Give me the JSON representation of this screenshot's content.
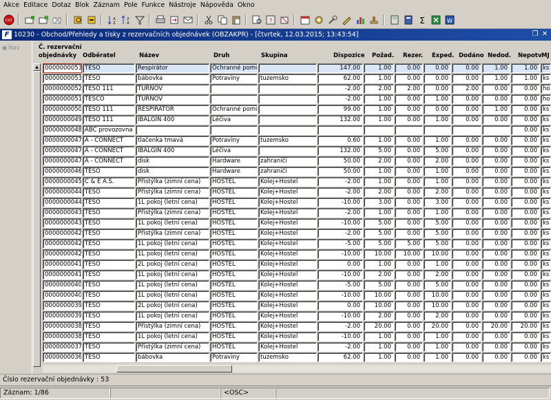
{
  "menu": [
    "Akce",
    "Editace",
    "Dotaz",
    "Blok",
    "Záznam",
    "Pole",
    "Funkce",
    "Nástroje",
    "Nápověda",
    "Okno"
  ],
  "toolbar": {
    "exit_label": "EXIT",
    "icons": [
      "exit-icon",
      "new-record-icon",
      "save-icon",
      "delete-icon",
      "query-icon",
      "execute-query-icon",
      "sort-asc-icon",
      "sort-desc-icon",
      "filter-icon",
      "print-icon",
      "export-icon",
      "email-icon",
      "cut-icon",
      "copy-icon",
      "paste-icon",
      "find-icon",
      "help-icon",
      "calendar-icon",
      "calculator-icon",
      "sum-icon",
      "excel-icon",
      "word-icon"
    ]
  },
  "window": {
    "title": "10230 - Obchod/Přehledy a tisky z rezervačních objednávek (OBZAKPR) - [čtvrtek, 12.03.2015; 13:43:54]"
  },
  "nav": {
    "label": "Nav"
  },
  "columns": {
    "c1a": "Č. rezervační",
    "c1b": "objednávky",
    "c2": "Odběratel",
    "c3": "Název",
    "c4": "Druh",
    "c5": "Skupina",
    "c6": "Dispozice",
    "c7": "Požad.",
    "c8": "Rezer.",
    "c9": "Exped.",
    "c10": "Dodáno",
    "c11": "Nedod.",
    "c12": "Nepotv.",
    "c13": "MJ"
  },
  "rows": [
    [
      "0000000053",
      "TESO",
      "Respirátor",
      "Ochranné pomůcky",
      "",
      "147.00",
      "1.00",
      "0.00",
      "0.00",
      "0.00",
      "1.00",
      "1.00",
      "ks"
    ],
    [
      "0000000053",
      "TESO",
      "bábovka",
      "Potraviny",
      "tuzemsko",
      "62.00",
      "1.00",
      "0.00",
      "0.00",
      "0.00",
      "1.00",
      "1.00",
      "ks"
    ],
    [
      "0000000052",
      "TESO 111",
      "TURNOV",
      "",
      "",
      "-2.00",
      "2.00",
      "2.00",
      "0.00",
      "2.00",
      "0.00",
      "0.00",
      "ho"
    ],
    [
      "0000000051",
      "TESCO",
      "TURNOV",
      "",
      "",
      "-2.00",
      "1.00",
      "0.00",
      "1.00",
      "0.00",
      "0.00",
      "0.00",
      "ho"
    ],
    [
      "0000000050",
      "TESO 111",
      "RESPIRÁTOR",
      "Ochranné pomůcky",
      "",
      "99.00",
      "1.00",
      "0.00",
      "0.00",
      "0.00",
      "1.00",
      "0.00",
      "ks"
    ],
    [
      "0000000049",
      "TESO 111",
      "IBALGIN 400",
      "Léčiva",
      "",
      "132.00",
      "1.00",
      "0.00",
      "1.00",
      "0.00",
      "0.00",
      "0.00",
      "ks"
    ],
    [
      "0000000048",
      "ABC provozovna Nový Bor",
      "",
      "",
      "",
      "",
      "",
      "",
      "",
      "",
      "",
      "0.00",
      "ks"
    ],
    [
      "0000000047",
      "A - CONNECT",
      "tlačenka tmavá",
      "Potraviny",
      "tuzemsko",
      "0.60",
      "1.00",
      "0.00",
      "1.00",
      "0.00",
      "0.00",
      "0.00",
      "ks"
    ],
    [
      "0000000047",
      "A - CONNECT",
      "IBALGIN 400",
      "Léčiva",
      "",
      "132.00",
      "5.00",
      "0.00",
      "5.00",
      "0.00",
      "0.00",
      "0.00",
      "ks"
    ],
    [
      "0000000047",
      "A - CONNECT",
      "disk",
      "Hardware",
      "zahraničí",
      "50.00",
      "2.00",
      "0.00",
      "2.00",
      "0.00",
      "0.00",
      "0.00",
      "ks"
    ],
    [
      "0000000046",
      "TESO",
      "disk",
      "Hardware",
      "zahraničí",
      "50.00",
      "1.00",
      "0.00",
      "1.00",
      "0.00",
      "0.00",
      "0.00",
      "ks"
    ],
    [
      "0000000045",
      "C & E A.S.",
      "Přistýlka (zimní cena)",
      "HOSTEL",
      "Kolej+Hostel",
      "-2.00",
      "1.00",
      "0.00",
      "1.00",
      "0.00",
      "0.00",
      "0.00",
      "ks"
    ],
    [
      "0000000044",
      "TESO",
      "Přistýlka (zimní cena)",
      "HOSTEL",
      "Kolej+Hostel",
      "-2.00",
      "2.00",
      "0.00",
      "2.00",
      "0.00",
      "0.00",
      "0.00",
      "ks"
    ],
    [
      "0000000044",
      "TESO",
      "1L pokoj (letní cena)",
      "HOSTEL",
      "Kolej+Hostel",
      "-10.00",
      "3.00",
      "0.00",
      "3.00",
      "0.00",
      "0.00",
      "0.00",
      "ks"
    ],
    [
      "0000000043",
      "TESO",
      "Přistýlka (zimní cena)",
      "HOSTEL",
      "Kolej+Hostel",
      "-2.00",
      "1.00",
      "0.00",
      "1.00",
      "0.00",
      "0.00",
      "0.00",
      "ks"
    ],
    [
      "0000000043",
      "TESO",
      "1L pokoj (letní cena)",
      "HOSTEL",
      "Kolej+Hostel",
      "-10.00",
      "5.00",
      "0.00",
      "5.00",
      "0.00",
      "0.00",
      "0.00",
      "ks"
    ],
    [
      "0000000042",
      "TESO",
      "Přistýlka (zimní cena)",
      "HOSTEL",
      "Kolej+Hostel",
      "-2.00",
      "5.00",
      "0.00",
      "5.00",
      "0.00",
      "0.00",
      "0.00",
      "ks"
    ],
    [
      "0000000042",
      "TESO",
      "1L pokoj (letní cena)",
      "HOSTEL",
      "Kolej+Hostel",
      "-5.00",
      "5.00",
      "5.00",
      "5.00",
      "0.00",
      "0.00",
      "0.00",
      "ks"
    ],
    [
      "0000000042",
      "TESO",
      "1L pokoj (letní cena)",
      "HOSTEL",
      "Kolej+Hostel",
      "-10.00",
      "10.00",
      "10.00",
      "10.00",
      "0.00",
      "0.00",
      "0.00",
      "ks"
    ],
    [
      "0000000041",
      "TESO",
      "2L pokoj (letní cena)",
      "HOSTEL",
      "Kolej+Hostel",
      "0.00",
      "1.00",
      "0.00",
      "1.00",
      "0.00",
      "0.00",
      "0.00",
      "ks"
    ],
    [
      "0000000041",
      "TESO",
      "1L pokoj (letní cena)",
      "HOSTEL",
      "Kolej+Hostel",
      "-10.00",
      "2.00",
      "0.00",
      "2.00",
      "0.00",
      "0.00",
      "0.00",
      "ks"
    ],
    [
      "0000000040",
      "TESO",
      "1L pokoj (letní cena)",
      "HOSTEL",
      "Kolej+Hostel",
      "-5.00",
      "5.00",
      "0.00",
      "5.00",
      "0.00",
      "0.00",
      "0.00",
      "ks"
    ],
    [
      "0000000040",
      "TESO",
      "1L pokoj (letní cena)",
      "HOSTEL",
      "Kolej+Hostel",
      "-10.00",
      "10.00",
      "0.00",
      "10.00",
      "0.00",
      "0.00",
      "0.00",
      "ks"
    ],
    [
      "0000000039",
      "TESO",
      "2L pokoj (letní cena)",
      "HOSTEL",
      "Kolej+Hostel",
      "0.00",
      "10.00",
      "0.00",
      "10.00",
      "0.00",
      "0.00",
      "0.00",
      "ks"
    ],
    [
      "0000000039",
      "TESO",
      "1L pokoj (letní cena)",
      "HOSTEL",
      "Kolej+Hostel",
      "-10.00",
      "2.00",
      "0.00",
      "2.00",
      "0.00",
      "0.00",
      "0.00",
      "ks"
    ],
    [
      "0000000038",
      "TESO",
      "Přistýlka (zimní cena)",
      "HOSTEL",
      "Kolej+Hostel",
      "-2.00",
      "20.00",
      "0.00",
      "20.00",
      "0.00",
      "20.00",
      "20.00",
      "ks"
    ],
    [
      "0000000038",
      "TESO",
      "1L pokoj (letní cena)",
      "HOSTEL",
      "Kolej+Hostel",
      "-10.00",
      "1.00",
      "0.00",
      "1.00",
      "0.00",
      "0.00",
      "0.00",
      "ks"
    ],
    [
      "0000000037",
      "TESO",
      "Přistýlka (zimní cena)",
      "HOSTEL",
      "Kolej+Hostel",
      "-2.00",
      "1.00",
      "0.00",
      "1.00",
      "0.00",
      "0.00",
      "0.00",
      "ks"
    ],
    [
      "0000000036",
      "TESO",
      "bábovka",
      "Potraviny",
      "tuzemsko",
      "62.00",
      "1.00",
      "0.00",
      "1.00",
      "0.00",
      "0.00",
      "0.00",
      "ks"
    ]
  ],
  "status": {
    "field_hint": "Číslo rezervační objednávky : 53",
    "record": "Záznam: 1/86",
    "mode": "<OSC>"
  },
  "colors": {
    "title_bg": "#0b2a7a",
    "selected_row": "#d8e6f7",
    "chrome": "#d4d0c8"
  }
}
